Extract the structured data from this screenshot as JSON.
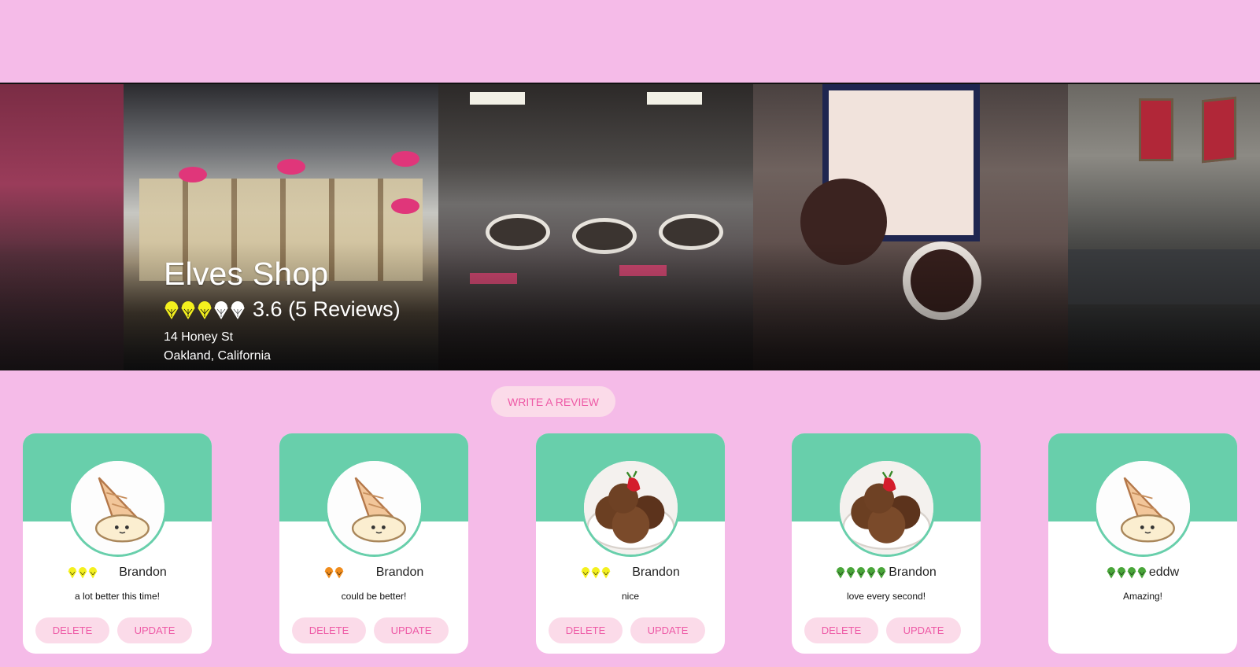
{
  "shop": {
    "name": "Elves Shop",
    "rating": "3.6",
    "reviews_text": "(5 Reviews)",
    "rating_value": 3.6,
    "rating_max": 5,
    "address_line1": "14 Honey St",
    "address_line2": "Oakland, California"
  },
  "write_review_label": "Write a review",
  "colors": {
    "page_bg": "#f5bbe8",
    "card_header": "#68cfab",
    "button_bg": "#fbdbe9",
    "button_text": "#ee5aa6",
    "cone_yellow": "#f4f01e",
    "cone_orange": "#f08c1c",
    "cone_green": "#4aa63a"
  },
  "reviews": [
    {
      "user": "Brandon",
      "comment": "a lot better this time!",
      "rating": 3,
      "cone_color": "yellow",
      "avatar": "melted-cone-avatar",
      "delete_label": "Delete",
      "update_label": "Update"
    },
    {
      "user": "Brandon",
      "comment": "could be better!",
      "rating": 2,
      "cone_color": "orange",
      "avatar": "melted-cone-avatar",
      "delete_label": "Delete",
      "update_label": "Update"
    },
    {
      "user": "Brandon",
      "comment": "nice",
      "rating": 3,
      "cone_color": "yellow",
      "avatar": "ice-cream-bowl-avatar",
      "delete_label": "Delete",
      "update_label": "Update"
    },
    {
      "user": "Brandon",
      "comment": "love every second!",
      "rating": 5,
      "cone_color": "green",
      "avatar": "ice-cream-bowl-avatar",
      "delete_label": "Delete",
      "update_label": "Update"
    },
    {
      "user": "eddw",
      "comment": "Amazing!",
      "rating": 4,
      "cone_color": "green",
      "avatar": "melted-cone-avatar"
    }
  ]
}
